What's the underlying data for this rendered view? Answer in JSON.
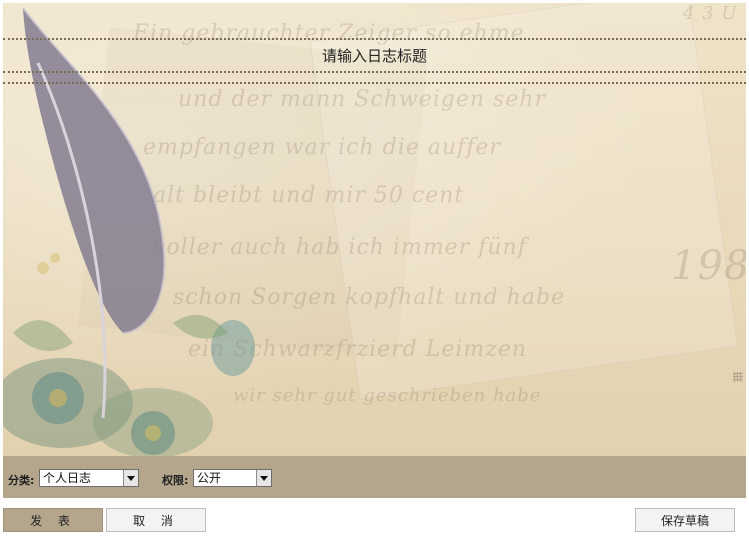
{
  "editor": {
    "title_placeholder": "请输入日志标题",
    "background_script": [
      "Ein gebrauchter Zeiger so ehme",
      "und der mann Schweigen sehr",
      "empfangen war ich die auffer",
      "alt bleibt und mir 50 cent",
      "voller auch hab ich immer fünf",
      "schon Sorgen kopfhalt und habe",
      "ein Schwarzfrzierd Leimzen",
      "wir sehr gut geschrieben habe"
    ],
    "background_numbers": [
      "4 3 U",
      "198."
    ]
  },
  "toolbar": {
    "category_label": "分类:",
    "category_value": "个人日志",
    "permission_label": "权限:",
    "permission_value": "公开"
  },
  "actions": {
    "publish_label": "发 表",
    "cancel_label": "取 消",
    "save_draft_label": "保存草稿"
  },
  "colors": {
    "toolbar_bg": "#b3a68d",
    "paper_bg": "#eadbbd",
    "dotted_rule": "#7a6b57"
  }
}
